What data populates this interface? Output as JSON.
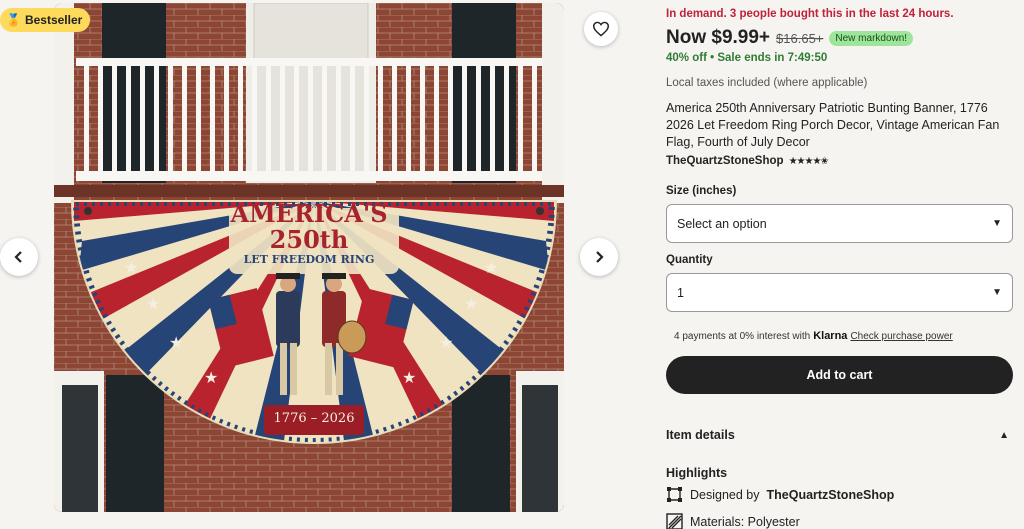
{
  "gallery": {
    "badge_label": "Bestseller",
    "banner": {
      "heading": "AMERICA'S",
      "number": "250th",
      "slogan": "LET FREEDOM RING",
      "years": "1776 – 2026"
    }
  },
  "product": {
    "demand_text": "In demand. 3 people bought this in the last 24 hours.",
    "price_now": "Now $9.99+",
    "price_old": "$16.65+",
    "markdown_badge": "New markdown!",
    "discount": "40% off",
    "sale_ends": "Sale ends in 7:49:50",
    "taxes_note": "Local taxes included (where applicable)",
    "title": "America 250th Anniversary Patriotic Bunting Banner, 1776 2026 Let Freedom Ring Porch Decor, Vintage American Fan Flag, Fourth of July Decor",
    "shop_name": "TheQuartzStoneShop",
    "rating_stars": "★★★★✬"
  },
  "options": {
    "size_label": "Size (inches)",
    "size_value": "Select an option",
    "quantity_label": "Quantity",
    "quantity_value": "1"
  },
  "klarna": {
    "text": "4 payments at 0% interest with",
    "brand": "Klarna",
    "link": "Check purchase power"
  },
  "cart_button": "Add to cart",
  "item_details": {
    "title": "Item details",
    "highlights_title": "Highlights",
    "designed_by_prefix": "Designed by",
    "designed_by_shop": "TheQuartzStoneShop",
    "materials": "Materials: Polyester"
  },
  "colors": {
    "demand_red": "#c0213b",
    "sale_green": "#2e7d32",
    "markdown_bg": "#9ee59b",
    "badge_yellow": "#fdd95c",
    "cart_bg": "#222222"
  }
}
